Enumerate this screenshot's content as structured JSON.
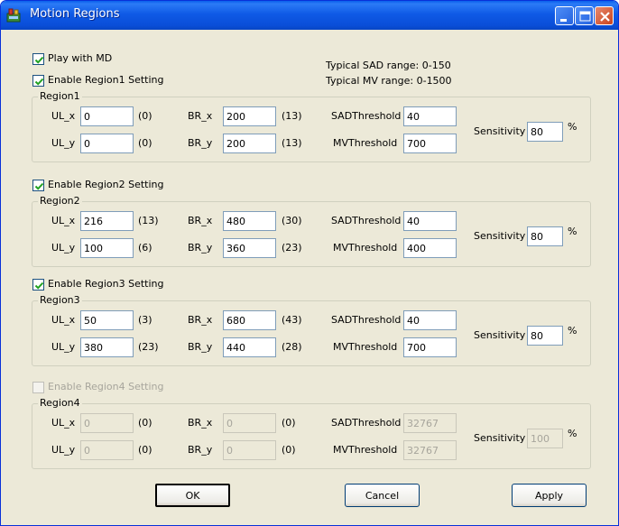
{
  "window": {
    "title": "Motion Regions",
    "icon": "app-icon"
  },
  "options": {
    "play_with_md": {
      "label": "Play with MD",
      "checked": true
    }
  },
  "info": {
    "sad_range": "Typical SAD range: 0-150",
    "mv_range": "Typical MV range: 0-1500"
  },
  "labels": {
    "ul_x": "UL_x",
    "ul_y": "UL_y",
    "br_x": "BR_x",
    "br_y": "BR_y",
    "sad_threshold": "SADThreshold",
    "mv_threshold": "MVThreshold",
    "sensitivity": "Sensitivity",
    "percent": "%"
  },
  "regions": [
    {
      "enable_label": "Enable Region1 Setting",
      "enabled": true,
      "name": "Region1",
      "ul_x": "0",
      "ul_x_block": "(0)",
      "ul_y": "0",
      "ul_y_block": "(0)",
      "br_x": "200",
      "br_x_block": "(13)",
      "br_y": "200",
      "br_y_block": "(13)",
      "sad_threshold": "40",
      "mv_threshold": "700",
      "sensitivity": "80"
    },
    {
      "enable_label": "Enable Region2 Setting",
      "enabled": true,
      "name": "Region2",
      "ul_x": "216",
      "ul_x_block": "(13)",
      "ul_y": "100",
      "ul_y_block": "(6)",
      "br_x": "480",
      "br_x_block": "(30)",
      "br_y": "360",
      "br_y_block": "(23)",
      "sad_threshold": "40",
      "mv_threshold": "400",
      "sensitivity": "80"
    },
    {
      "enable_label": "Enable Region3 Setting",
      "enabled": true,
      "name": "Region3",
      "ul_x": "50",
      "ul_x_block": "(3)",
      "ul_y": "380",
      "ul_y_block": "(23)",
      "br_x": "680",
      "br_x_block": "(43)",
      "br_y": "440",
      "br_y_block": "(28)",
      "sad_threshold": "40",
      "mv_threshold": "700",
      "sensitivity": "80"
    },
    {
      "enable_label": "Enable Region4 Setting",
      "enabled": false,
      "name": "Region4",
      "ul_x": "0",
      "ul_x_block": "(0)",
      "ul_y": "0",
      "ul_y_block": "(0)",
      "br_x": "0",
      "br_x_block": "(0)",
      "br_y": "0",
      "br_y_block": "(0)",
      "sad_threshold": "32767",
      "mv_threshold": "32767",
      "sensitivity": "100"
    }
  ],
  "buttons": {
    "ok": "OK",
    "cancel": "Cancel",
    "apply": "Apply"
  }
}
